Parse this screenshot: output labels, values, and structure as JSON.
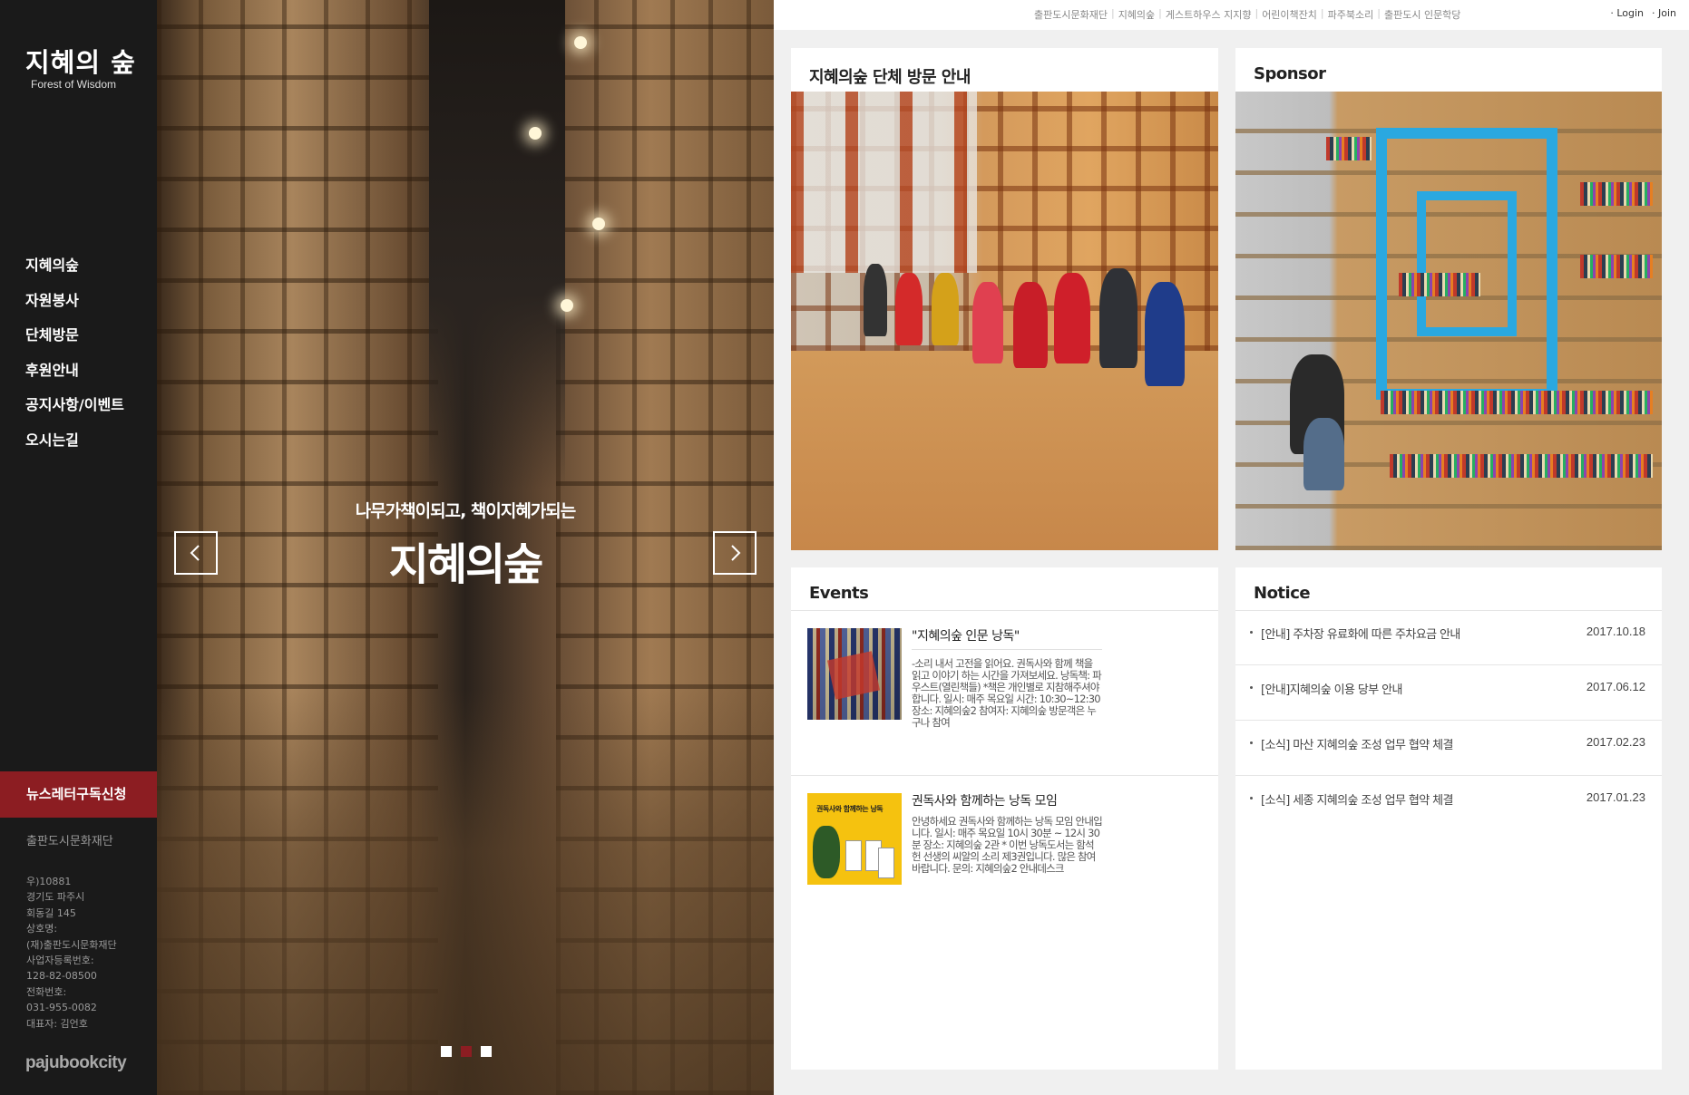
{
  "sidebar": {
    "logo_ko": "지혜의 숲",
    "logo_en": "Forest of Wisdom",
    "nav": [
      "지혜의숲",
      "자원봉사",
      "단체방문",
      "후원안내",
      "공지사항/이벤트",
      "오시는길"
    ],
    "newsletter": "뉴스레터구독신청",
    "foundation": "출판도시문화재단",
    "address": [
      "우)10881",
      "경기도 파주시",
      "회동길 145",
      "상호명:",
      "(재)출판도시문화재단",
      "사업자등록번호:",
      "128-82-08500",
      "전화번호:",
      "031-955-0082",
      "대표자: 김언호"
    ],
    "footer_logo": "pajubookcity"
  },
  "hero": {
    "subtitle": "나무가책이되고, 책이지혜가되는",
    "title": "지혜의숲",
    "slides": 3,
    "active_slide": 2,
    "accent": "#8c1d22"
  },
  "topbar": {
    "links": [
      "출판도시문화재단",
      "지혜의숲",
      "게스트하우스 지지향",
      "어린이책잔치",
      "파주북소리",
      "출판도시 인문학당"
    ],
    "login": "· Login",
    "join": "· Join"
  },
  "visit": {
    "title": "지혜의숲 단체 방문 안내"
  },
  "sponsor": {
    "title": "Sponsor"
  },
  "events": {
    "title": "Events",
    "items": [
      {
        "title": "\"지혜의숲 인문 낭독\"",
        "desc": "-소리 내서 고전을 읽어요. 권독사와 함께 책을 읽고 이야기 하는 시간을 가져보세요. 낭독책: 파우스트(열린책들) *책은 개인별로 지참해주셔야 합니다. 일시: 매주 목요일 시간: 10:30~12:30 장소: 지혜의숲2 참여자: 지혜의숲 방문객은 누구나 참여"
      },
      {
        "title": "권독사와 함께하는 낭독 모임",
        "desc": "안녕하세요 권독사와 함께하는 낭독 모임 안내입니다. 일시: 매주 목요일 10시 30분 ~ 12시 30분 장소: 지혜의숲 2관 * 이번 낭독도서는 함석헌 선생의 씨알의 소리 제3권입니다. 많은 참여 바랍니다. 문의: 지혜의숲2 안내데스크",
        "thumb_label": "권독사와 함께하는 낭독"
      }
    ]
  },
  "notice": {
    "title": "Notice",
    "items": [
      {
        "text": "[안내] 주차장 유료화에 따른 주차요금 안내",
        "date": "2017.10.18"
      },
      {
        "text": "[안내]지혜의숲 이용 당부 안내",
        "date": "2017.06.12"
      },
      {
        "text": "[소식] 마산 지혜의숲 조성 업무 협약 체결",
        "date": "2017.02.23"
      },
      {
        "text": "[소식] 세종 지혜의숲 조성 업무 협약 체결",
        "date": "2017.01.23"
      }
    ]
  }
}
